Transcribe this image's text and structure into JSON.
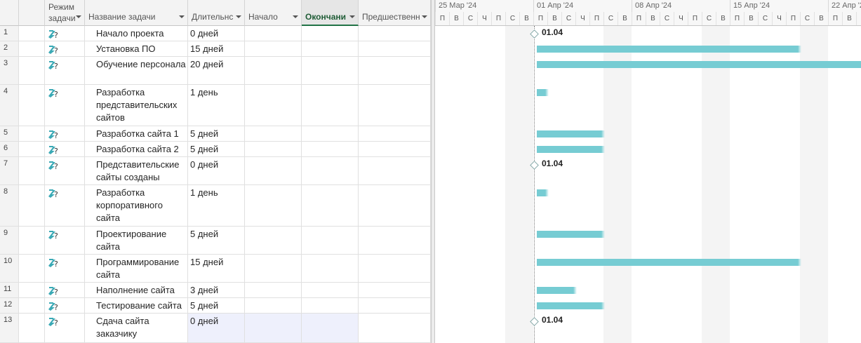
{
  "columns": {
    "id": "",
    "info_icon": "info-icon",
    "mode": "Режим задачи",
    "name": "Название задачи",
    "duration": "Длительность",
    "start": "Начало",
    "end": "Окончание",
    "pred": "Предшественники"
  },
  "columns_display": {
    "mode_line1": "Режим",
    "mode_line2": "задачи",
    "name": "Название задачи",
    "duration": "Длительнс",
    "start": "Начало",
    "end": "Окончани",
    "pred": "Предшественн"
  },
  "tasks": [
    {
      "id": "1",
      "name": "Начало проекта",
      "duration": "0 дней",
      "milestone": true,
      "label": "01.04"
    },
    {
      "id": "2",
      "name": "Установка ПО",
      "duration": "15 дней"
    },
    {
      "id": "3",
      "name": "Обучение персонала",
      "duration": "20 дней"
    },
    {
      "id": "4",
      "name": "Разработка представительских сайтов",
      "duration": "1 день"
    },
    {
      "id": "5",
      "name": "Разработка сайта 1",
      "duration": "5 дней"
    },
    {
      "id": "6",
      "name": "Разработка сайта 2",
      "duration": "5 дней"
    },
    {
      "id": "7",
      "name": "Представительские сайты созданы",
      "duration": "0 дней",
      "milestone": true,
      "label": "01.04"
    },
    {
      "id": "8",
      "name": "Разработка корпоративного сайта",
      "duration": "1 день"
    },
    {
      "id": "9",
      "name": "Проектирование сайта",
      "duration": "5 дней"
    },
    {
      "id": "10",
      "name": "Программирование сайта",
      "duration": "15 дней"
    },
    {
      "id": "11",
      "name": "Наполнение сайта",
      "duration": "3 дней"
    },
    {
      "id": "12",
      "name": "Тестирование сайта",
      "duration": "5 дней"
    },
    {
      "id": "13",
      "name": "Сдача сайта заказчику",
      "duration": "0 дней",
      "milestone": true,
      "label": "01.04"
    }
  ],
  "timescale": {
    "weeks": [
      "25 Мар '24",
      "01 Апр '24",
      "08 Апр '24",
      "15 Апр '24",
      "22 Апр '24"
    ],
    "days": [
      "П",
      "В",
      "С",
      "Ч",
      "П",
      "С",
      "В"
    ]
  },
  "colors": {
    "bar": "#76ccd3",
    "accent": "#217346",
    "selection": "#eef0fc"
  }
}
